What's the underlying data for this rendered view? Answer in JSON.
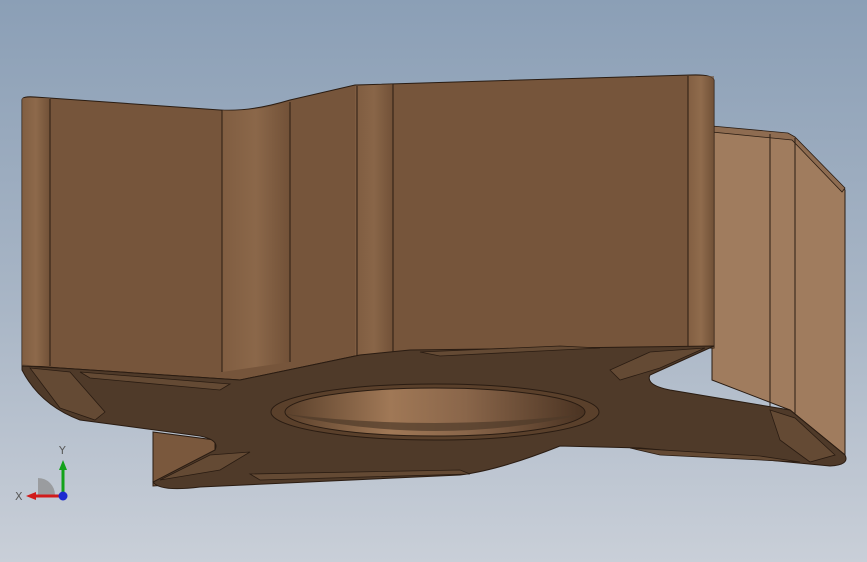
{
  "viewport": {
    "colors": {
      "background_top": "#8b9fb6",
      "background_bottom": "#c9cfd8",
      "model_face": "#76553b",
      "model_side": "#a07c5e",
      "model_bottom": "#4f3a29",
      "edge": "#2a1c12"
    }
  },
  "triad": {
    "x_label": "X",
    "y_label": "Y",
    "x_color": "#d11b1b",
    "y_color": "#13a21a",
    "z_color": "#1d2ad1"
  }
}
